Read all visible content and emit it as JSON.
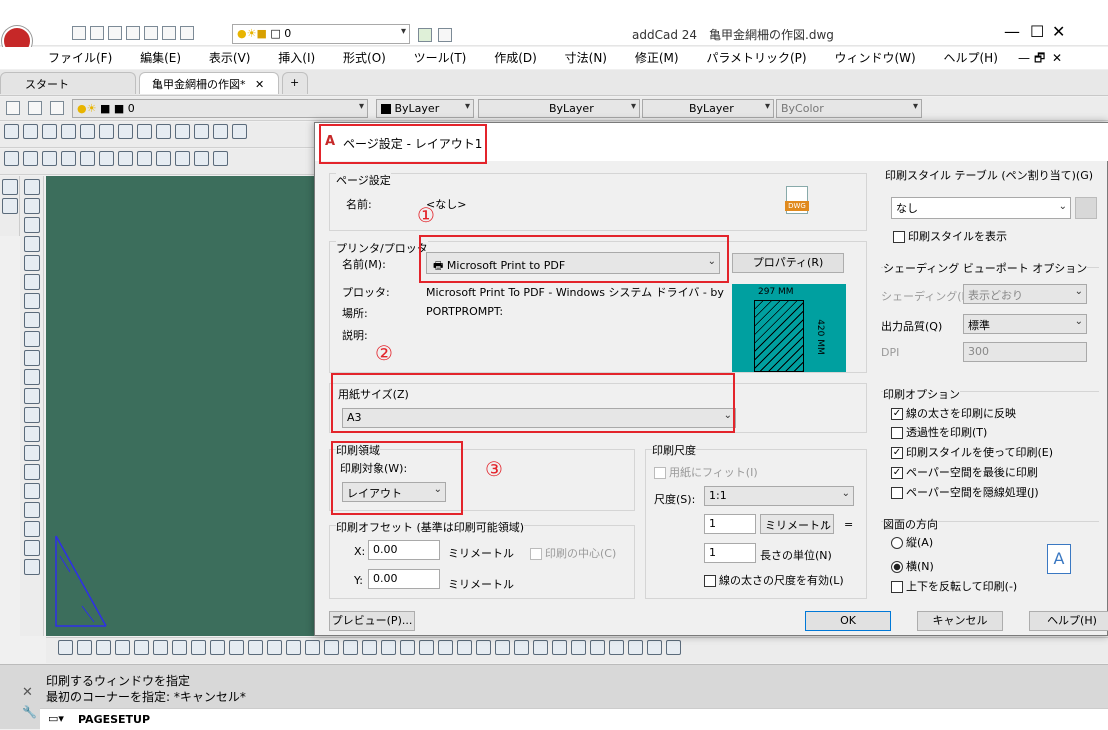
{
  "window": {
    "title": "addCad 24　亀甲金網柵の作図.dwg",
    "layer_value": "0"
  },
  "menu": [
    "ファイル(F)",
    "編集(E)",
    "表示(V)",
    "挿入(I)",
    "形式(O)",
    "ツール(T)",
    "作成(D)",
    "寸法(N)",
    "修正(M)",
    "パラメトリック(P)",
    "ウィンドウ(W)",
    "ヘルプ(H)"
  ],
  "tabs": {
    "start": "スタート",
    "doc": "亀甲金網柵の作図*",
    "close": "✕",
    "add": "+"
  },
  "props": {
    "layer": "0",
    "color": "ByLayer",
    "linetype": "ByLayer",
    "lineweight": "ByLayer",
    "plotstyle": "ByColor"
  },
  "command": {
    "line1": "印刷するウィンドウを指定",
    "line2": "最初のコーナーを指定: *キャンセル*",
    "input": "PAGESETUP"
  },
  "dialog": {
    "title": "ページ設定 - レイアウト1",
    "page_setup": {
      "section": "ページ設定",
      "name_label": "名前:",
      "name_value": "<なし>",
      "dwg_icon": "DWG"
    },
    "printer": {
      "section": "プリンタ/プロッタ",
      "name_label": "名前(M):",
      "name_value": "Microsoft Print to PDF",
      "properties": "プロパティ(R)",
      "plotter_label": "プロッタ:",
      "plotter_value": "Microsoft Print To PDF - Windows システム ドライバ - by ...",
      "where_label": "場所:",
      "where_value": "PORTPROMPT:",
      "desc_label": "説明:",
      "preview_w": "297 MM",
      "preview_h": "420 MM"
    },
    "paper": {
      "section": "用紙サイズ(Z)",
      "value": "A3"
    },
    "area": {
      "section": "印刷領域",
      "what_label": "印刷対象(W):",
      "what_value": "レイアウト"
    },
    "offset": {
      "section": "印刷オフセット (基準は印刷可能領域)",
      "x_label": "X:",
      "x_value": "0.00",
      "y_label": "Y:",
      "y_value": "0.00",
      "unit": "ミリメートル",
      "center": "印刷の中心(C)"
    },
    "scale": {
      "section": "印刷尺度",
      "fit": "用紙にフィット(I)",
      "scale_label": "尺度(S):",
      "scale_value": "1:1",
      "num1": "1",
      "unit": "ミリメートル",
      "eq": "=",
      "num2": "1",
      "unit2": "長さの単位(N)",
      "lw": "線の太さの尺度を有効(L)"
    },
    "style": {
      "section": "印刷スタイル テーブル (ペン割り当て)(G)",
      "value": "なし",
      "display": "印刷スタイルを表示"
    },
    "shade": {
      "section": "シェーディング ビューポート オプション",
      "shade_label": "シェーディング(D)",
      "shade_value": "表示どおり",
      "quality_label": "出力品質(Q)",
      "quality_value": "標準",
      "dpi_label": "DPI",
      "dpi_value": "300"
    },
    "options": {
      "section": "印刷オプション",
      "items": [
        "線の太さを印刷に反映",
        "透過性を印刷(T)",
        "印刷スタイルを使って印刷(E)",
        "ペーパー空間を最後に印刷",
        "ペーパー空間を隠線処理(J)"
      ],
      "checked": [
        true,
        false,
        true,
        true,
        false
      ]
    },
    "orientation": {
      "section": "図面の方向",
      "portrait": "縦(A)",
      "landscape": "横(N)",
      "upside": "上下を反転して印刷(-)"
    },
    "buttons": {
      "preview": "プレビュー(P)...",
      "ok": "OK",
      "cancel": "キャンセル",
      "help": "ヘルプ(H)"
    }
  },
  "annotations": {
    "n1": "①",
    "n2": "②",
    "n3": "③"
  },
  "colors": {
    "canvas": "#3c6e5c",
    "accent": "#e3242b",
    "preview": "#00a0a0"
  }
}
